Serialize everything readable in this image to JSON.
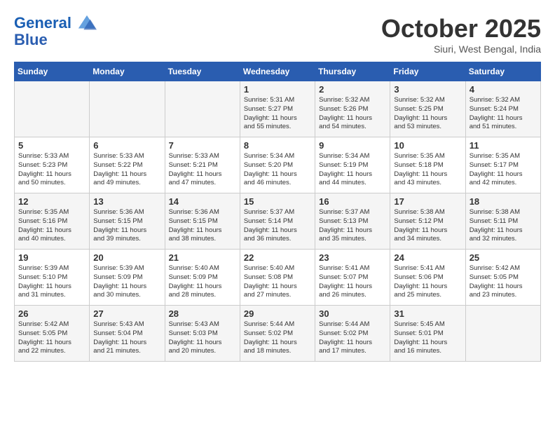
{
  "header": {
    "logo_line1": "General",
    "logo_line2": "Blue",
    "month": "October 2025",
    "location": "Siuri, West Bengal, India"
  },
  "weekdays": [
    "Sunday",
    "Monday",
    "Tuesday",
    "Wednesday",
    "Thursday",
    "Friday",
    "Saturday"
  ],
  "weeks": [
    [
      {
        "day": "",
        "info": ""
      },
      {
        "day": "",
        "info": ""
      },
      {
        "day": "",
        "info": ""
      },
      {
        "day": "1",
        "info": "Sunrise: 5:31 AM\nSunset: 5:27 PM\nDaylight: 11 hours\nand 55 minutes."
      },
      {
        "day": "2",
        "info": "Sunrise: 5:32 AM\nSunset: 5:26 PM\nDaylight: 11 hours\nand 54 minutes."
      },
      {
        "day": "3",
        "info": "Sunrise: 5:32 AM\nSunset: 5:25 PM\nDaylight: 11 hours\nand 53 minutes."
      },
      {
        "day": "4",
        "info": "Sunrise: 5:32 AM\nSunset: 5:24 PM\nDaylight: 11 hours\nand 51 minutes."
      }
    ],
    [
      {
        "day": "5",
        "info": "Sunrise: 5:33 AM\nSunset: 5:23 PM\nDaylight: 11 hours\nand 50 minutes."
      },
      {
        "day": "6",
        "info": "Sunrise: 5:33 AM\nSunset: 5:22 PM\nDaylight: 11 hours\nand 49 minutes."
      },
      {
        "day": "7",
        "info": "Sunrise: 5:33 AM\nSunset: 5:21 PM\nDaylight: 11 hours\nand 47 minutes."
      },
      {
        "day": "8",
        "info": "Sunrise: 5:34 AM\nSunset: 5:20 PM\nDaylight: 11 hours\nand 46 minutes."
      },
      {
        "day": "9",
        "info": "Sunrise: 5:34 AM\nSunset: 5:19 PM\nDaylight: 11 hours\nand 44 minutes."
      },
      {
        "day": "10",
        "info": "Sunrise: 5:35 AM\nSunset: 5:18 PM\nDaylight: 11 hours\nand 43 minutes."
      },
      {
        "day": "11",
        "info": "Sunrise: 5:35 AM\nSunset: 5:17 PM\nDaylight: 11 hours\nand 42 minutes."
      }
    ],
    [
      {
        "day": "12",
        "info": "Sunrise: 5:35 AM\nSunset: 5:16 PM\nDaylight: 11 hours\nand 40 minutes."
      },
      {
        "day": "13",
        "info": "Sunrise: 5:36 AM\nSunset: 5:15 PM\nDaylight: 11 hours\nand 39 minutes."
      },
      {
        "day": "14",
        "info": "Sunrise: 5:36 AM\nSunset: 5:15 PM\nDaylight: 11 hours\nand 38 minutes."
      },
      {
        "day": "15",
        "info": "Sunrise: 5:37 AM\nSunset: 5:14 PM\nDaylight: 11 hours\nand 36 minutes."
      },
      {
        "day": "16",
        "info": "Sunrise: 5:37 AM\nSunset: 5:13 PM\nDaylight: 11 hours\nand 35 minutes."
      },
      {
        "day": "17",
        "info": "Sunrise: 5:38 AM\nSunset: 5:12 PM\nDaylight: 11 hours\nand 34 minutes."
      },
      {
        "day": "18",
        "info": "Sunrise: 5:38 AM\nSunset: 5:11 PM\nDaylight: 11 hours\nand 32 minutes."
      }
    ],
    [
      {
        "day": "19",
        "info": "Sunrise: 5:39 AM\nSunset: 5:10 PM\nDaylight: 11 hours\nand 31 minutes."
      },
      {
        "day": "20",
        "info": "Sunrise: 5:39 AM\nSunset: 5:09 PM\nDaylight: 11 hours\nand 30 minutes."
      },
      {
        "day": "21",
        "info": "Sunrise: 5:40 AM\nSunset: 5:09 PM\nDaylight: 11 hours\nand 28 minutes."
      },
      {
        "day": "22",
        "info": "Sunrise: 5:40 AM\nSunset: 5:08 PM\nDaylight: 11 hours\nand 27 minutes."
      },
      {
        "day": "23",
        "info": "Sunrise: 5:41 AM\nSunset: 5:07 PM\nDaylight: 11 hours\nand 26 minutes."
      },
      {
        "day": "24",
        "info": "Sunrise: 5:41 AM\nSunset: 5:06 PM\nDaylight: 11 hours\nand 25 minutes."
      },
      {
        "day": "25",
        "info": "Sunrise: 5:42 AM\nSunset: 5:05 PM\nDaylight: 11 hours\nand 23 minutes."
      }
    ],
    [
      {
        "day": "26",
        "info": "Sunrise: 5:42 AM\nSunset: 5:05 PM\nDaylight: 11 hours\nand 22 minutes."
      },
      {
        "day": "27",
        "info": "Sunrise: 5:43 AM\nSunset: 5:04 PM\nDaylight: 11 hours\nand 21 minutes."
      },
      {
        "day": "28",
        "info": "Sunrise: 5:43 AM\nSunset: 5:03 PM\nDaylight: 11 hours\nand 20 minutes."
      },
      {
        "day": "29",
        "info": "Sunrise: 5:44 AM\nSunset: 5:02 PM\nDaylight: 11 hours\nand 18 minutes."
      },
      {
        "day": "30",
        "info": "Sunrise: 5:44 AM\nSunset: 5:02 PM\nDaylight: 11 hours\nand 17 minutes."
      },
      {
        "day": "31",
        "info": "Sunrise: 5:45 AM\nSunset: 5:01 PM\nDaylight: 11 hours\nand 16 minutes."
      },
      {
        "day": "",
        "info": ""
      }
    ]
  ]
}
